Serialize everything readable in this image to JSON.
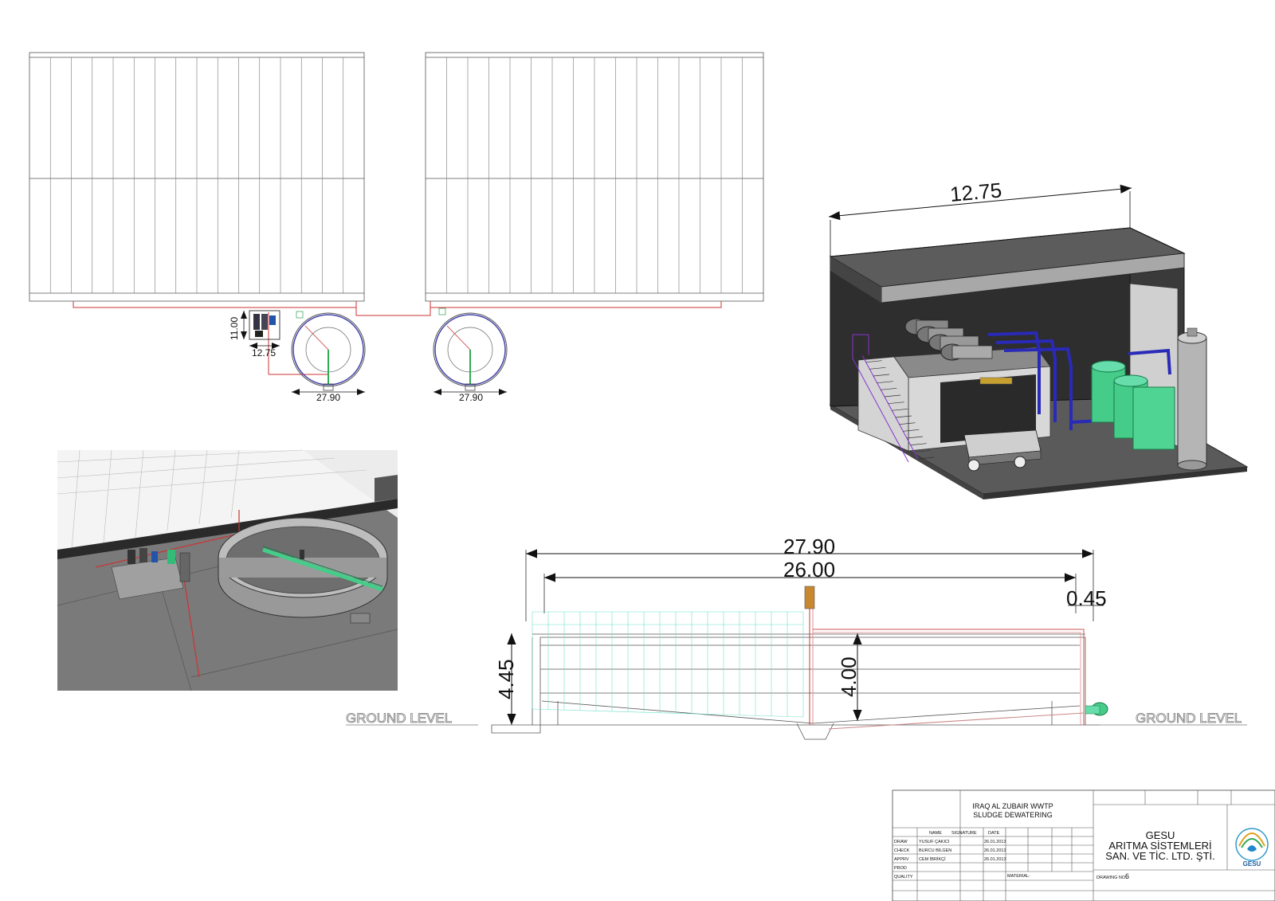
{
  "plan_view": {
    "dim_building_depth": "11.00",
    "dim_building_width": "12.75",
    "dim_clarifier_1": "27.90",
    "dim_clarifier_2": "27.90"
  },
  "building_3d": {
    "dim_width": "12.75"
  },
  "section_view": {
    "dim_outer_diameter": "27.90",
    "dim_inner_diameter": "26.00",
    "dim_wall": "0.45",
    "dim_total_height": "4.45",
    "dim_water_depth": "4.00",
    "ground_left": "GROUND LEVEL",
    "ground_right": "GROUND LEVEL"
  },
  "title_block": {
    "project_line1": "IRAQ AL ZUBAIR WWTP",
    "project_line2": "SLUDGE DEWATERING",
    "col_name": "NAME",
    "col_signature": "SIGNATURE",
    "col_date": "DATE",
    "rows": [
      {
        "role": "DRAW",
        "name": "YUSUF ÇAKICI",
        "date": "26.01.2013"
      },
      {
        "role": "CHECK",
        "name": "BURCU BİLGEN",
        "date": "26.01.2013"
      },
      {
        "role": "APPRV",
        "name": "CEM İBRİKÇİ",
        "date": "26.01.2013"
      },
      {
        "role": "PROD",
        "name": "",
        "date": ""
      },
      {
        "role": "QUALITY",
        "name": "",
        "date": ""
      }
    ],
    "material_label": "MATERIAL:",
    "company_line1": "GESU",
    "company_line2": "ARITMA SİSTEMLERİ",
    "company_line3": "SAN. VE TİC. LTD. ŞTİ.",
    "drawing_no_label": "DRAWING NO:",
    "drawing_no": "6",
    "logo_text": "GESU"
  },
  "colors": {
    "line": "#444444",
    "pipe_red": "#cc3333",
    "pipe_blue": "#2222aa",
    "tank_green": "#44cc88",
    "stair_purple": "#8833cc",
    "wall_dark": "#333333",
    "floor_gray": "#5a5a5a"
  }
}
